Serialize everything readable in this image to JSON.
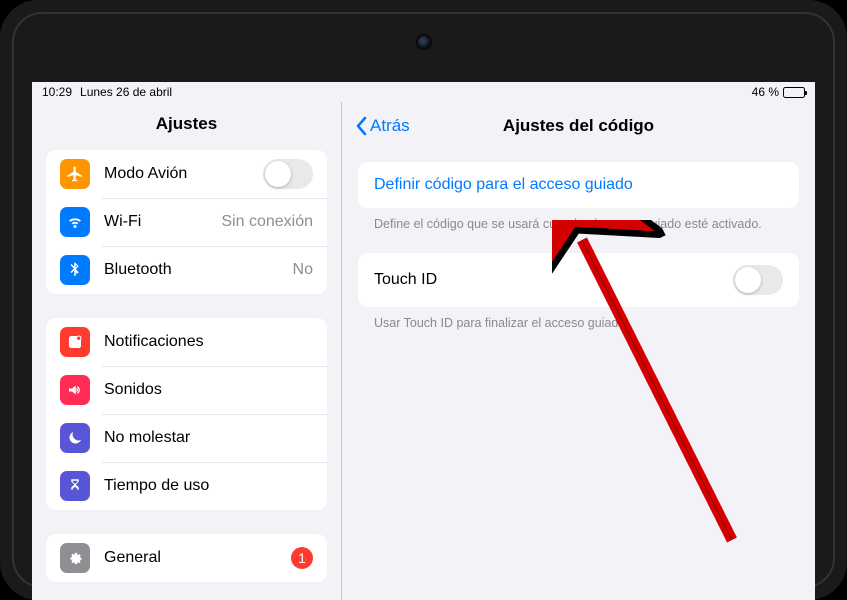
{
  "status": {
    "time": "10:29",
    "date": "Lunes 26 de abril",
    "battery_pct": "46 %"
  },
  "sidebar": {
    "title": "Ajustes",
    "group1": {
      "airplane": {
        "label": "Modo Avión"
      },
      "wifi": {
        "label": "Wi-Fi",
        "detail": "Sin conexión"
      },
      "bluetooth": {
        "label": "Bluetooth",
        "detail": "No"
      }
    },
    "group2": {
      "notifications": {
        "label": "Notificaciones"
      },
      "sounds": {
        "label": "Sonidos"
      },
      "dnd": {
        "label": "No molestar"
      },
      "screentime": {
        "label": "Tiempo de uso"
      }
    },
    "group3": {
      "general": {
        "label": "General",
        "badge": "1"
      }
    }
  },
  "detail": {
    "back": "Atrás",
    "title": "Ajustes del código",
    "set_passcode": "Definir código para el acceso guiado",
    "footer1": "Define el código que se usará cuando el acceso guiado esté activado.",
    "touchid": "Touch ID",
    "footer2": "Usar Touch ID para finalizar el acceso guiado."
  },
  "colors": {
    "accent": "#007aff",
    "badge": "#ff3b30"
  }
}
